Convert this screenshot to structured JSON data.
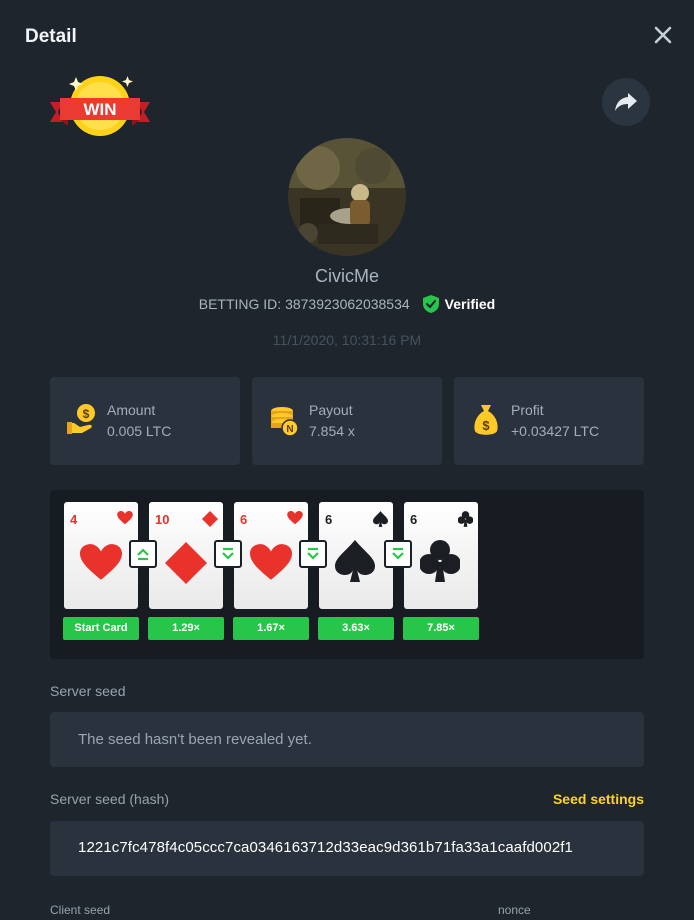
{
  "header": {
    "title": "Detail"
  },
  "badge": {
    "text": "WIN"
  },
  "user": {
    "name": "CivicMe",
    "betting_id_label": "BETTING ID:",
    "betting_id": "3873923062038534",
    "verified_label": "Verified"
  },
  "timestamp": "11/1/2020, 10:31:16 PM",
  "stats": {
    "amount": {
      "label": "Amount",
      "value": "0.005 LTC"
    },
    "payout": {
      "label": "Payout",
      "value": "7.854 x"
    },
    "profit": {
      "label": "Profit",
      "value": "+0.03427 LTC"
    }
  },
  "cards": [
    {
      "rank": "4",
      "suit": "heart",
      "color": "#e8322b",
      "multiplier": "Start Card"
    },
    {
      "rank": "10",
      "suit": "diamond",
      "color": "#e8322b",
      "multiplier": "1.29×",
      "arrow": "up"
    },
    {
      "rank": "6",
      "suit": "heart",
      "color": "#e8322b",
      "multiplier": "1.67×",
      "arrow": "down"
    },
    {
      "rank": "6",
      "suit": "spade",
      "color": "#1b1f23",
      "multiplier": "3.63×",
      "arrow": "down"
    },
    {
      "rank": "6",
      "suit": "club",
      "color": "#1b1f23",
      "multiplier": "7.85×",
      "arrow": "down"
    }
  ],
  "server_seed": {
    "label": "Server seed",
    "message": "The seed hasn't been revealed yet."
  },
  "server_seed_hash": {
    "label": "Server seed (hash)",
    "value": "1221c7fc478f4c05ccc7ca0346163712d33eac9d361b71fa33a1caafd002f1",
    "settings_link": "Seed settings"
  },
  "client_seed": {
    "label": "Client seed"
  },
  "nonce": {
    "label": "nonce"
  },
  "colors": {
    "background": "#1e252d",
    "panel": "#2a333d",
    "accent_green": "#27c64a",
    "accent_yellow": "#ffd21f",
    "card_red": "#e8322b"
  }
}
